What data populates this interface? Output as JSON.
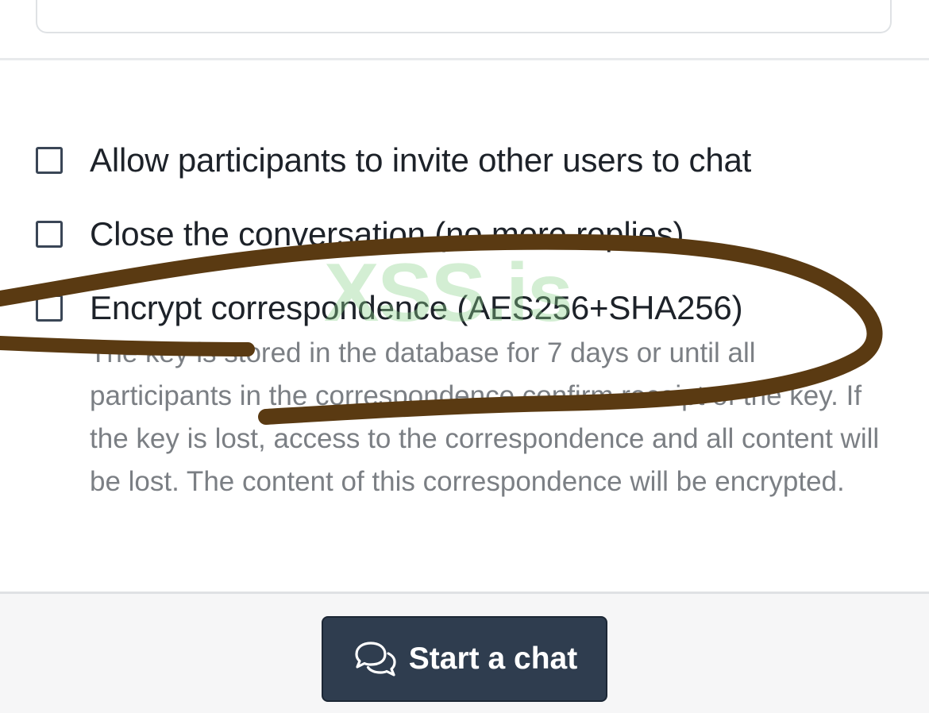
{
  "options": [
    {
      "label": "Allow participants to invite other users to chat",
      "checked": false
    },
    {
      "label": "Close the conversation (no more replies)",
      "checked": false
    },
    {
      "label": "Encrypt correspondence (AES256+SHA256)",
      "checked": false
    }
  ],
  "encrypt_hint": "The key is stored in the database for 7 days or until all participants in the correspondence confirm receipt of the key. If the key is lost, access to the correspondence and all content will be lost. The content of this correspondence will be encrypted.",
  "start_button": {
    "label": "Start a chat",
    "icon": "comments-icon"
  },
  "watermark": "XSS.is",
  "colors": {
    "button_bg": "#2f3d4f",
    "annotation_stroke": "#5a3a12",
    "watermark": "#8cd28c"
  }
}
